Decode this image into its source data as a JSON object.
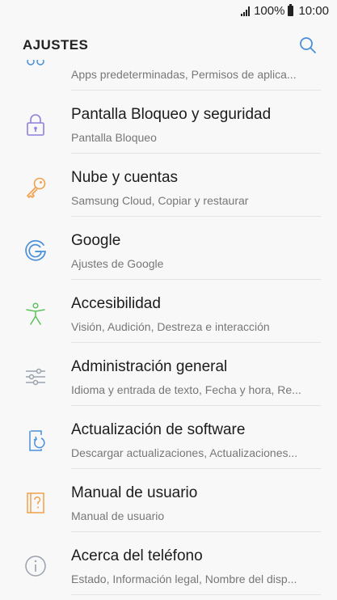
{
  "status": {
    "battery": "100%",
    "time": "10:00"
  },
  "header": {
    "title": "AJUSTES"
  },
  "items": [
    {
      "title": "",
      "subtitle": "Apps predeterminadas, Permisos de aplica..."
    },
    {
      "title": "Pantalla Bloqueo y seguridad",
      "subtitle": "Pantalla Bloqueo"
    },
    {
      "title": "Nube y cuentas",
      "subtitle": "Samsung Cloud, Copiar y restaurar"
    },
    {
      "title": "Google",
      "subtitle": "Ajustes de Google"
    },
    {
      "title": "Accesibilidad",
      "subtitle": "Visión, Audición, Destreza e interacción"
    },
    {
      "title": "Administración general",
      "subtitle": "Idioma y entrada de texto, Fecha y hora, Re..."
    },
    {
      "title": "Actualización de software",
      "subtitle": "Descargar actualizaciones, Actualizaciones..."
    },
    {
      "title": "Manual de usuario",
      "subtitle": "Manual de usuario"
    },
    {
      "title": "Acerca del teléfono",
      "subtitle": "Estado, Información legal, Nombre del disp..."
    }
  ],
  "colors": {
    "lock": "#8f7fe0",
    "key": "#f0a04b",
    "google": "#4a90d9",
    "accessibility": "#5cc05c",
    "general": "#9aa2ad",
    "update": "#4a90d9",
    "manual": "#f0a04b",
    "about": "#9aa2ad"
  }
}
